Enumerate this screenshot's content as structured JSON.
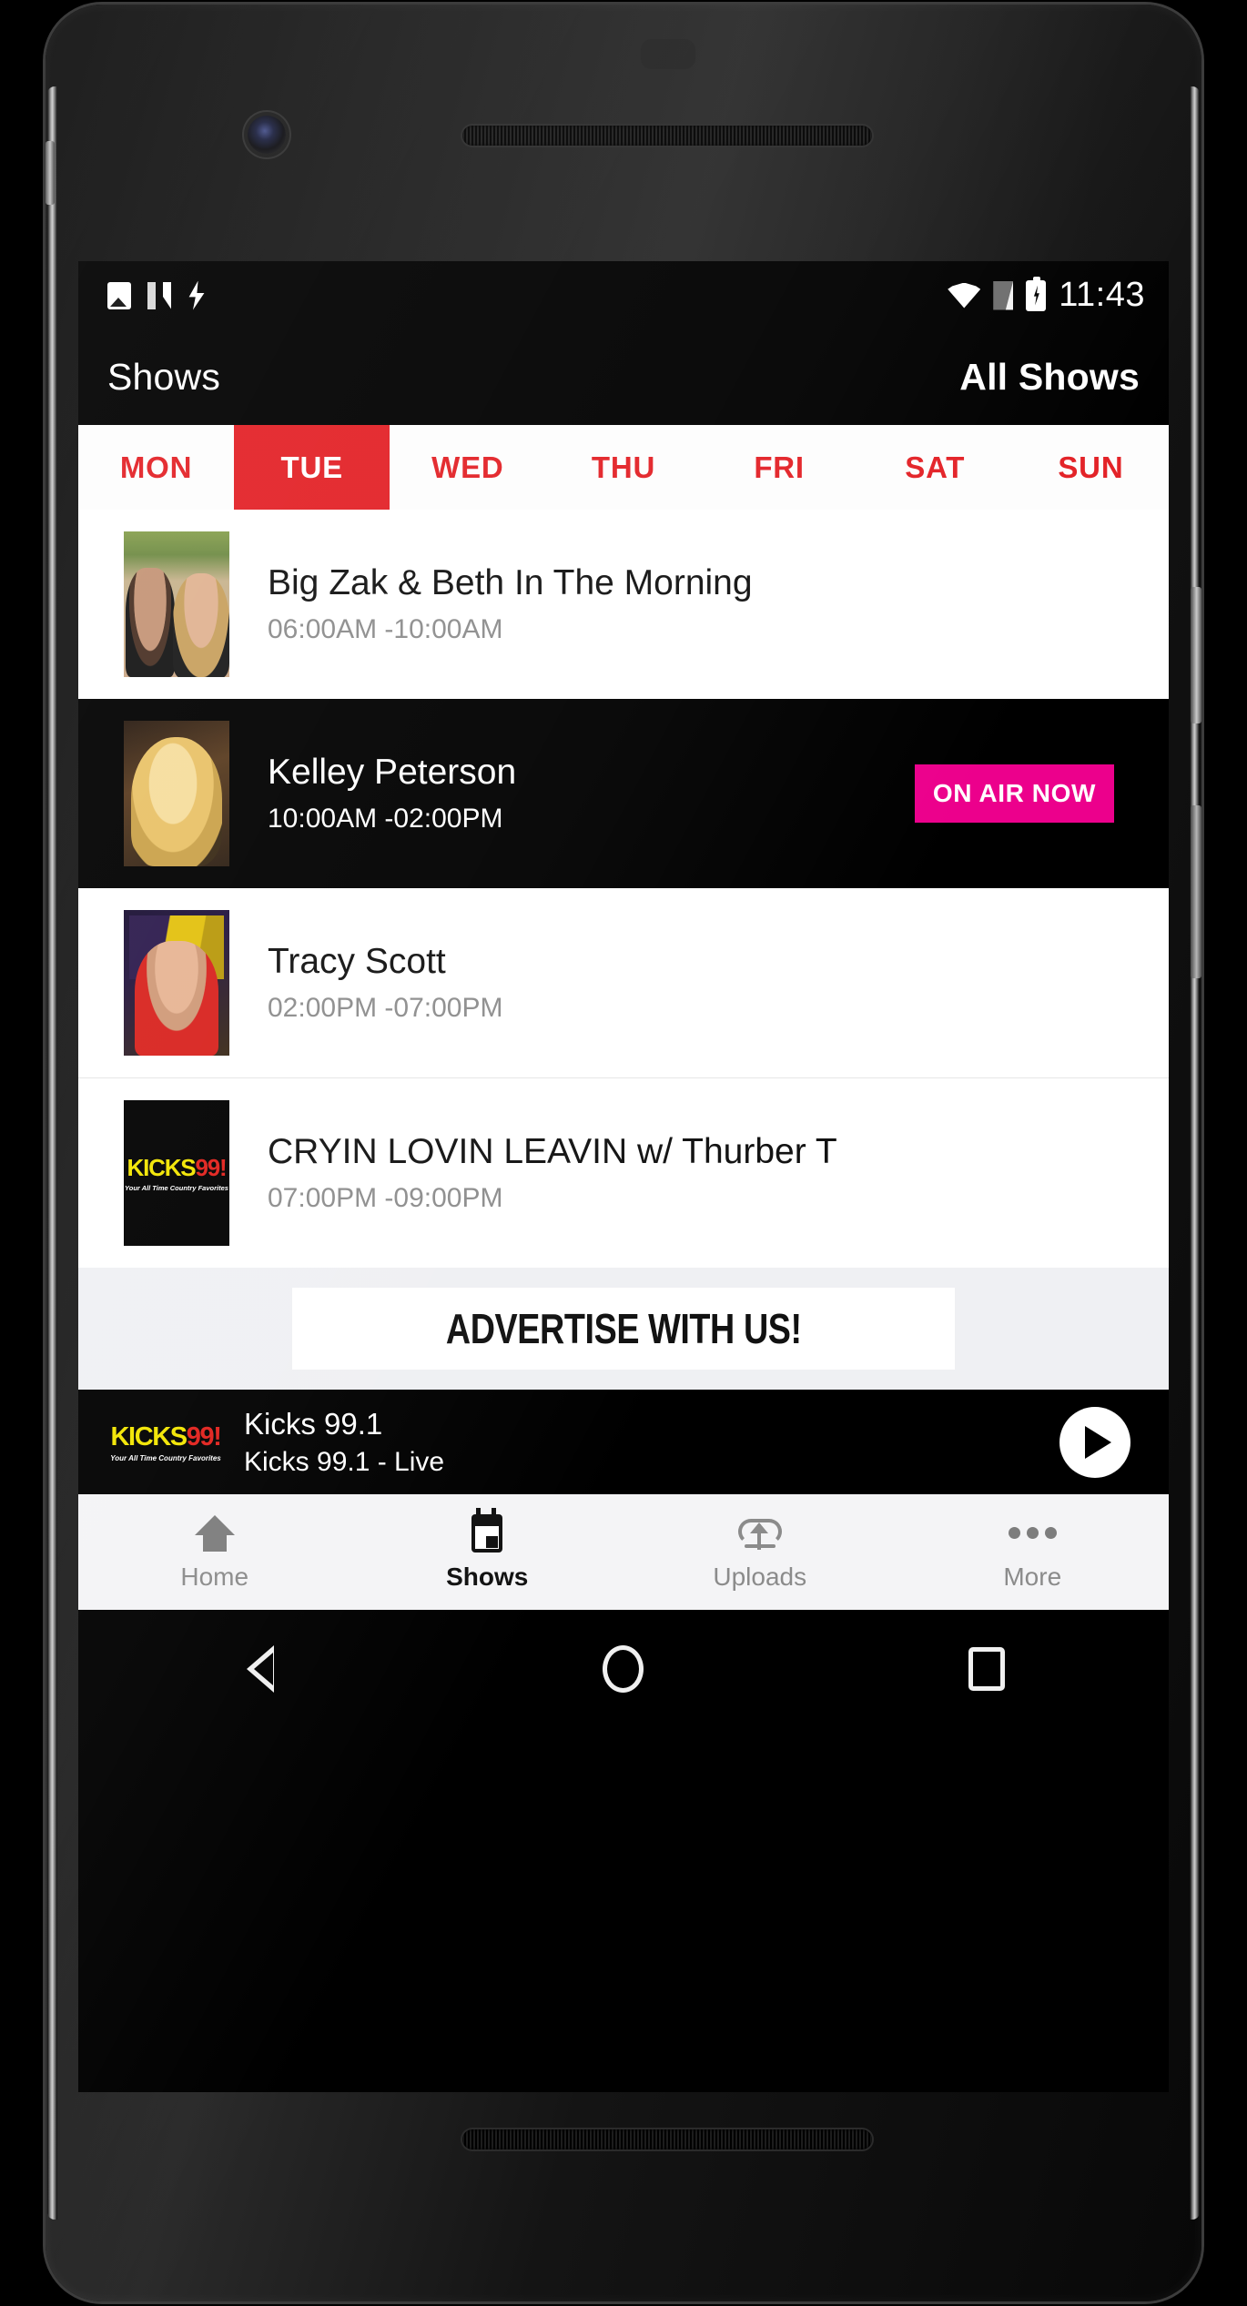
{
  "status_bar": {
    "time": "11:43",
    "left_icons": [
      "image-icon",
      "nova-n-icon",
      "bolt-icon"
    ],
    "right_icons": [
      "wifi-icon",
      "sim-off-icon",
      "battery-charging-icon"
    ]
  },
  "header": {
    "title": "Shows",
    "all_shows_label": "All Shows"
  },
  "day_tabs": [
    {
      "label": "MON",
      "active": false
    },
    {
      "label": "TUE",
      "active": true
    },
    {
      "label": "WED",
      "active": false
    },
    {
      "label": "THU",
      "active": false
    },
    {
      "label": "FRI",
      "active": false
    },
    {
      "label": "SAT",
      "active": false
    },
    {
      "label": "SUN",
      "active": false
    }
  ],
  "shows": [
    {
      "title": "Big Zak & Beth In The Morning",
      "time": "06:00AM -10:00AM",
      "on_air": false,
      "thumb": "hosts-photo"
    },
    {
      "title": "Kelley Peterson",
      "time": "10:00AM -02:00PM",
      "on_air": true,
      "on_air_label": "ON AIR NOW",
      "thumb": "host-photo"
    },
    {
      "title": "Tracy Scott",
      "time": "02:00PM -07:00PM",
      "on_air": false,
      "thumb": "host-photo"
    },
    {
      "title": "CRYIN LOVIN LEAVIN w/ Thurber T",
      "time": "07:00PM -09:00PM",
      "on_air": false,
      "thumb": "station-logo"
    }
  ],
  "ad": {
    "text": "ADVERTISE WITH US!"
  },
  "player": {
    "station_logo_main": "KICKS",
    "station_logo_accent": "99!",
    "station_logo_tagline": "Your All Time Country Favorites",
    "title": "Kicks 99.1",
    "subtitle": "Kicks 99.1 - Live",
    "play_icon": "play-icon"
  },
  "bottom_nav": [
    {
      "label": "Home",
      "icon": "home-icon",
      "active": false
    },
    {
      "label": "Shows",
      "icon": "calendar-icon",
      "active": true
    },
    {
      "label": "Uploads",
      "icon": "cloud-upload-icon",
      "active": false
    },
    {
      "label": "More",
      "icon": "more-dots-icon",
      "active": false
    }
  ],
  "android_nav": [
    "back-icon",
    "home-circle-icon",
    "recents-square-icon"
  ],
  "colors": {
    "accent_red": "#e32227",
    "on_air_magenta": "#ec008c",
    "logo_yellow": "#f2e500",
    "logo_red": "#e2211c",
    "ad_background": "#eff0f3"
  }
}
